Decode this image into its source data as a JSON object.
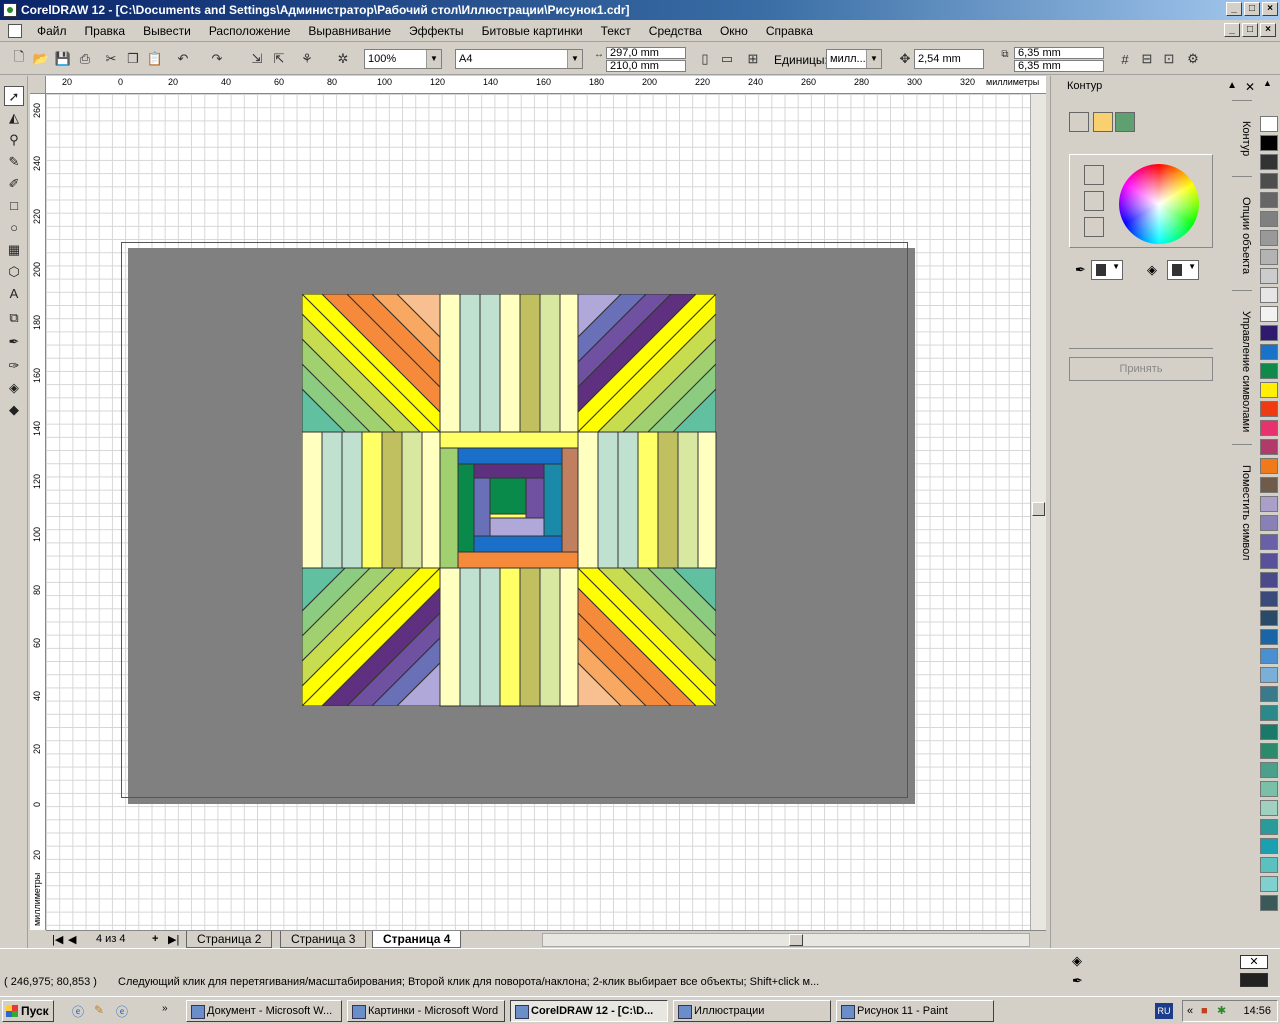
{
  "window": {
    "title": "CorelDRAW 12 - [C:\\Documents and Settings\\Администратор\\Рабочий стол\\Иллюстрации\\Рисунок1.cdr]",
    "min": "_",
    "max": "□",
    "close": "×"
  },
  "menu": [
    "Файл",
    "Правка",
    "Вывести",
    "Расположение",
    "Выравнивание",
    "Эффекты",
    "Битовые картинки",
    "Текст",
    "Средства",
    "Окно",
    "Справка"
  ],
  "toolbar": {
    "zoom": "100%",
    "paper": "A4",
    "width": "297,0 mm",
    "height": "210,0 mm",
    "units_label": "Единицы:",
    "units_value": "милл...",
    "nudge": "2,54 mm",
    "dup_x": "6,35 mm",
    "dup_y": "6,35 mm"
  },
  "ruler": {
    "h_labels": [
      "20",
      "0",
      "20",
      "40",
      "60",
      "80",
      "100",
      "120",
      "140",
      "160",
      "180",
      "200",
      "220",
      "240",
      "260",
      "280",
      "300",
      "320"
    ],
    "h_unit": "миллиметры",
    "v_labels": [
      "260",
      "240",
      "220",
      "200",
      "180",
      "160",
      "140",
      "120",
      "100",
      "80",
      "60",
      "40",
      "20",
      "0",
      "20"
    ],
    "v_unit": "миллиметры"
  },
  "pages": {
    "counter": "4 из 4",
    "tabs": [
      "Страница 2",
      "Страница 3",
      "Страница 4"
    ],
    "active": "Страница 4"
  },
  "docker": {
    "title": "Контур",
    "apply": "Принять",
    "tabs": [
      "Контур",
      "Опции объекта",
      "Управление символами",
      "Поместить символ"
    ]
  },
  "palette": [
    "#ffffff",
    "#000000",
    "#333333",
    "#4d4d4d",
    "#666666",
    "#808080",
    "#999999",
    "#b3b3b3",
    "#cccccc",
    "#e6e6e6",
    "#f2f2f2",
    "#2e1a6e",
    "#1a73c8",
    "#0f8a4a",
    "#ffef00",
    "#ef3a12",
    "#e8326e",
    "#b03a6a",
    "#f07a1a",
    "#705a4a",
    "#a8a0c8",
    "#8a80b8",
    "#6a60a8",
    "#58509a",
    "#4a4a8a",
    "#3a4a7a",
    "#2a4a6a",
    "#1a64a8",
    "#4a90d0",
    "#7ab0d8",
    "#3a7a8a",
    "#2a8a8a",
    "#1a7a6a",
    "#2a8a6a",
    "#4aa08a",
    "#7ac0a8",
    "#a0d0c0",
    "#2a9a9a",
    "#1aa0b0",
    "#5ac0c0",
    "#80d0d0",
    "#3a5a5a"
  ],
  "status": {
    "coords": "( 246,975; 80,853 )",
    "hint": "Следующий клик для перетягивания/масштабирования; Второй клик для поворота/наклона; 2-клик выбирает все объекты; Shift+click м..."
  },
  "taskbar": {
    "start": "Пуск",
    "tasks": [
      "Документ - Microsoft W...",
      "Картинки - Microsoft Word",
      "CorelDRAW 12 - [C:\\D...",
      "Иллюстрации",
      "Рисунок 11 - Paint"
    ],
    "lang": "RU",
    "clock": "14:56"
  },
  "artwork": {
    "colors": {
      "yellow": "#ffff00",
      "pale_yellow": "#ffffc0",
      "light_yellow": "#ffff66",
      "lime": "#c8dc50",
      "olive": "#c0c060",
      "pale_green": "#d8e8a0",
      "mint": "#c0e0d0",
      "teal": "#60c0a0",
      "green": "#a0d070",
      "orange": "#f58a3a",
      "light_orange": "#f8a860",
      "peach": "#f8c090",
      "purple": "#603080",
      "violet": "#7050a0",
      "blue_violet": "#6a70b8",
      "lavender": "#b0a8d8",
      "blue": "#1a70c8",
      "dark_green": "#0a8a4a",
      "steel": "#1a8aa8",
      "brown": "#c08060"
    }
  }
}
